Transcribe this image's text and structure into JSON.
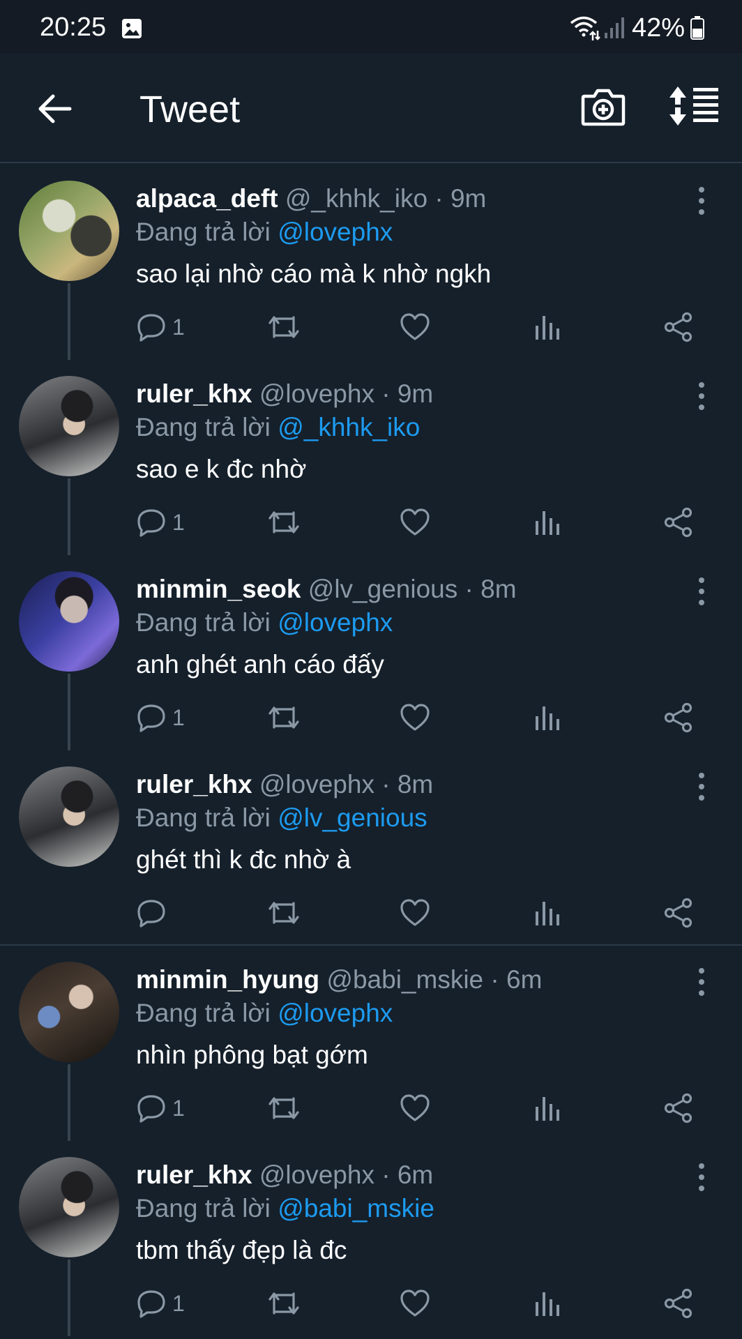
{
  "status_bar": {
    "time": "20:25",
    "battery": "42%"
  },
  "header": {
    "title": "Tweet"
  },
  "labels": {
    "replying_to": "Đang trả lời"
  },
  "tweets": [
    {
      "name": "alpaca_deft",
      "handle": "@_khhk_iko",
      "time": "9m",
      "reply_to": "@lovephx",
      "text": "sao lại nhờ cáo mà k nhờ ngkh",
      "reply_count": "1"
    },
    {
      "name": "ruler_khx",
      "handle": "@lovephx",
      "time": "9m",
      "reply_to": "@_khhk_iko",
      "text": "sao e k đc nhờ",
      "reply_count": "1"
    },
    {
      "name": "minmin_seok",
      "handle": "@lv_genious",
      "time": "8m",
      "reply_to": "@lovephx",
      "text": "anh ghét anh cáo đấy",
      "reply_count": "1"
    },
    {
      "name": "ruler_khx",
      "handle": "@lovephx",
      "time": "8m",
      "reply_to": "@lv_genious",
      "text": "ghét thì k đc nhờ à",
      "reply_count": ""
    },
    {
      "name": "minmin_hyung",
      "handle": "@babi_mskie",
      "time": "6m",
      "reply_to": "@lovephx",
      "text": "nhìn phông bạt gớm",
      "reply_count": "1"
    },
    {
      "name": "ruler_khx",
      "handle": "@lovephx",
      "time": "6m",
      "reply_to": "@babi_mskie",
      "text": "tbm thấy đẹp là đc",
      "reply_count": "1"
    }
  ],
  "colors": {
    "background": "#15202b",
    "accent": "#1d9bf0",
    "secondary_text": "#8b98a5",
    "divider": "#2c3947"
  }
}
